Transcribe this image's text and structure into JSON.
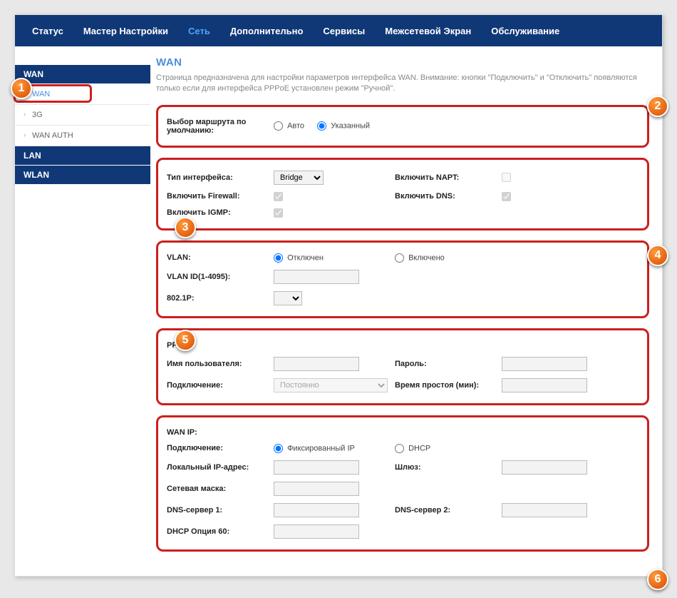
{
  "nav": [
    "Статус",
    "Мастер Настройки",
    "Сеть",
    "Дополнительно",
    "Сервисы",
    "Межсетевой Экран",
    "Обслуживание"
  ],
  "nav_active_index": 2,
  "sidebar": {
    "groups": [
      {
        "head": "WAN",
        "items": [
          "WAN",
          "3G",
          "WAN AUTH"
        ],
        "active_item": 0
      },
      {
        "head": "LAN",
        "items": []
      },
      {
        "head": "WLAN",
        "items": []
      }
    ]
  },
  "page": {
    "title": "WAN",
    "desc": "Страница предназначена для настройки параметров интерфейса WAN. Внимание: кнопки \"Подключить\" и \"Отключить\" появляются только если для интерфейса PPPoE установлен режим \"Ручной\"."
  },
  "route": {
    "label": "Выбор маршрута по умолчанию:",
    "opt_auto": "Авто",
    "opt_spec": "Указанный",
    "selected": "spec"
  },
  "iface": {
    "type_label": "Тип интерфейса:",
    "type_value": "Bridge",
    "napt_label": "Включить NAPT:",
    "napt": false,
    "fw_label": "Включить Firewall:",
    "fw": true,
    "dns_label": "Включить DNS:",
    "dns": true,
    "igmp_label": "Включить IGMP:",
    "igmp": true
  },
  "vlan": {
    "label": "VLAN:",
    "off": "Отключен",
    "on": "Включено",
    "selected": "off",
    "id_label": "VLAN ID(1-4095):",
    "id_value": "",
    "p_label": "802.1P:",
    "p_value": ""
  },
  "ppp": {
    "head": "PPP:",
    "user_label": "Имя пользователя:",
    "user_value": "",
    "pass_label": "Пароль:",
    "pass_value": "",
    "conn_label": "Подключение:",
    "conn_value": "Постоянно",
    "idle_label": "Время простоя (мин):",
    "idle_value": ""
  },
  "wanip": {
    "head": "WAN IP:",
    "conn_label": "Подключение:",
    "fixed": "Фиксированный IP",
    "dhcp": "DHCP",
    "selected": "fixed",
    "local_label": "Локальный IP-адрес:",
    "local_value": "",
    "gw_label": "Шлюз:",
    "gw_value": "",
    "mask_label": "Сетевая маска:",
    "mask_value": "",
    "dns1_label": "DNS-сервер 1:",
    "dns1_value": "",
    "dns2_label": "DNS-сервер 2:",
    "dns2_value": "",
    "opt60_label": "DHCP Опция 60:",
    "opt60_value": ""
  },
  "markers": [
    "1",
    "2",
    "3",
    "4",
    "5",
    "6"
  ]
}
